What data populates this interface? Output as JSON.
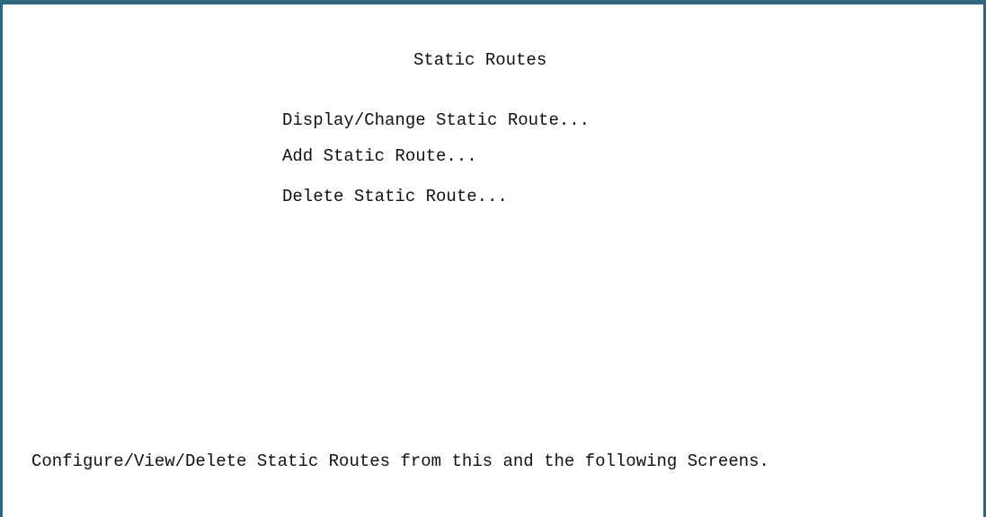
{
  "screen": {
    "title": "Static Routes"
  },
  "menu": {
    "items": [
      {
        "label": "Display/Change Static Route..."
      },
      {
        "label": "Add Static Route..."
      },
      {
        "label": "Delete Static Route..."
      }
    ]
  },
  "status": {
    "message": "Configure/View/Delete Static Routes from this and the following Screens."
  },
  "colors": {
    "frame_border": "#2e6680",
    "background": "#ffffff",
    "text": "#111111"
  }
}
